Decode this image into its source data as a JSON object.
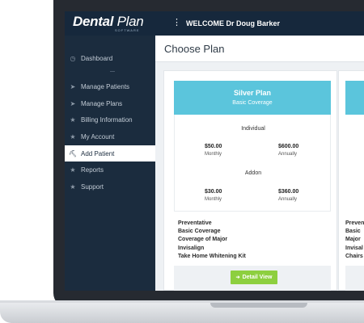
{
  "app": {
    "logo_main": "Dental",
    "logo_light": "Plan",
    "logo_sub": "SOFTWARE",
    "welcome": "WELCOME Dr Doug Barker"
  },
  "sidebar": {
    "items": [
      {
        "label": "Dashboard",
        "icon": "dashboard-icon",
        "glyph": "◷"
      },
      {
        "label": "Manage Patients",
        "icon": "paper-plane-icon",
        "glyph": "➤"
      },
      {
        "label": "Manage Plans",
        "icon": "paper-plane-icon",
        "glyph": "➤"
      },
      {
        "label": "Billing Information",
        "icon": "star-icon",
        "glyph": "★"
      },
      {
        "label": "My Account",
        "icon": "star-icon",
        "glyph": "★"
      },
      {
        "label": "Add Patient",
        "icon": "user-add-icon",
        "glyph": "⛏"
      },
      {
        "label": "Reports",
        "icon": "star-icon",
        "glyph": "★"
      },
      {
        "label": "Support",
        "icon": "star-icon",
        "glyph": "★"
      }
    ],
    "active_index": 5
  },
  "main": {
    "title": "Choose Plan"
  },
  "plans": [
    {
      "name": "Silver Plan",
      "subtitle": "Basic Coverage",
      "individual_label": "Individual",
      "individual_monthly_price": "$50.00",
      "individual_monthly_label": "Monthly",
      "individual_annual_price": "$600.00",
      "individual_annual_label": "Annually",
      "addon_label": "Addon",
      "addon_monthly_price": "$30.00",
      "addon_monthly_label": "Monthly",
      "addon_annual_price": "$360.00",
      "addon_annual_label": "Annually",
      "features": [
        "Preventative",
        "Basic Coverage",
        "Coverage of Major",
        "Invisalign",
        "Take Home Whitening Kit"
      ],
      "button_label": "Detail View"
    },
    {
      "features": [
        "Preven",
        "Basic",
        "Major",
        "Invisal",
        "Chairs"
      ]
    }
  ],
  "colors": {
    "topbar": "#16283c",
    "sidebar": "#1b2c3e",
    "plan_header": "#5bc5dc",
    "button": "#8dcf3f"
  }
}
